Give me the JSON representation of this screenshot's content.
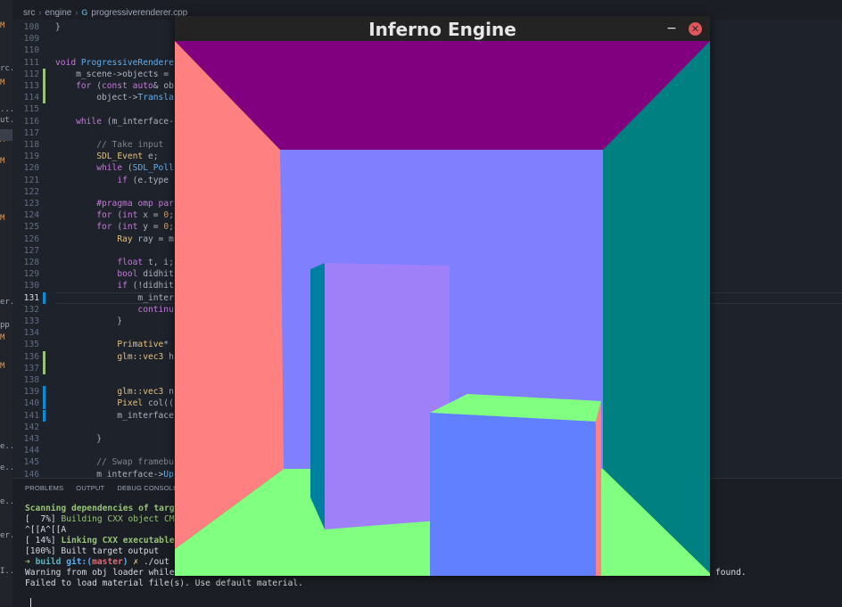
{
  "breadcrumb": [
    "src",
    "engine",
    "progressiverenderer.cpp"
  ],
  "sidebar": [
    {
      "label": "M",
      "modified": true
    },
    {
      "label": "rc..."
    },
    {
      "label": "M",
      "modified": true
    },
    {
      "label": "..."
    },
    {
      "label": "ut..."
    },
    {
      "label": "M",
      "modified": true
    },
    {
      "label": "M",
      "modified": true
    },
    {
      "label": "M",
      "modified": true
    },
    {
      "label": "er..."
    },
    {
      "label": "pp"
    },
    {
      "label": "M",
      "modified": true
    },
    {
      "label": "M",
      "modified": true
    },
    {
      "label": "e..."
    },
    {
      "label": "e..."
    },
    {
      "label": "e..."
    },
    {
      "label": "er..."
    },
    {
      "label": "I..."
    }
  ],
  "editor": {
    "current_line": 131,
    "lines": [
      {
        "n": 108,
        "text": "}"
      },
      {
        "n": 109,
        "text": ""
      },
      {
        "n": 110,
        "text": ""
      },
      {
        "n": 111,
        "text": "void ProgressiveRendere"
      },
      {
        "n": 112,
        "text": "    m_scene->objects = "
      },
      {
        "n": 113,
        "text": "    for (const auto& ob"
      },
      {
        "n": 114,
        "text": "        object->Transla"
      },
      {
        "n": 115,
        "text": ""
      },
      {
        "n": 116,
        "text": "    while (m_interface-"
      },
      {
        "n": 117,
        "text": ""
      },
      {
        "n": 118,
        "text": "        // Take input"
      },
      {
        "n": 119,
        "text": "        SDL_Event e;"
      },
      {
        "n": 120,
        "text": "        while (SDL_Poll"
      },
      {
        "n": 121,
        "text": "            if (e.type "
      },
      {
        "n": 122,
        "text": ""
      },
      {
        "n": 123,
        "text": "        #pragma omp par"
      },
      {
        "n": 124,
        "text": "        for (int x = 0;"
      },
      {
        "n": 125,
        "text": "        for (int y = 0;"
      },
      {
        "n": 126,
        "text": "            Ray ray = m"
      },
      {
        "n": 127,
        "text": ""
      },
      {
        "n": 128,
        "text": "            float t, i;"
      },
      {
        "n": 129,
        "text": "            bool didhit"
      },
      {
        "n": 130,
        "text": "            if (!didhit"
      },
      {
        "n": 131,
        "text": "                m_inter"
      },
      {
        "n": 132,
        "text": "                continu"
      },
      {
        "n": 133,
        "text": "            }"
      },
      {
        "n": 134,
        "text": ""
      },
      {
        "n": 135,
        "text": "            Primative* "
      },
      {
        "n": 136,
        "text": "            glm::vec3 h"
      },
      {
        "n": 137,
        "text": ""
      },
      {
        "n": 138,
        "text": ""
      },
      {
        "n": 139,
        "text": "            glm::vec3 n"
      },
      {
        "n": 140,
        "text": "            Pixel col(("
      },
      {
        "n": 141,
        "text": "            m_interface"
      },
      {
        "n": 142,
        "text": ""
      },
      {
        "n": 143,
        "text": "        }"
      },
      {
        "n": 144,
        "text": ""
      },
      {
        "n": 145,
        "text": "        // Swap framebu"
      },
      {
        "n": 146,
        "text": "        m_interface->Up"
      }
    ]
  },
  "panel": {
    "tabs": [
      "PROBLEMS",
      "OUTPUT",
      "DEBUG CONSOLE"
    ],
    "terminal": [
      {
        "prefix": "",
        "text": "Scanning dependencies of targ"
      },
      {
        "prefix": "[  7%] ",
        "text": "Building CXX object CM"
      },
      {
        "prefix": "",
        "text": "^[[A^[[A"
      },
      {
        "prefix": "[ 14%] ",
        "text": "Linking CXX executable"
      },
      {
        "prefix": "",
        "text": "[100%] Built target output"
      },
      {
        "prompt_arrow": "➜",
        "dir": "build",
        "git_label": "git:(",
        "branch": "master",
        "git_close": ")",
        "dirty": "✗",
        "cmd": "./out"
      },
      {
        "prefix": "",
        "text": "Warning from obj loader while",
        "tail": "found."
      },
      {
        "prefix": "",
        "text": "Failed to load material file(s). Use default material."
      }
    ]
  },
  "window": {
    "title": "Inferno Engine",
    "minimize_icon": "−",
    "close_icon": "✕",
    "colors": {
      "ceiling": "#800080",
      "back_wall": "#8080ff",
      "left_wall": "#ff8080",
      "right_wall": "#008080",
      "floor": "#80ff80",
      "tall_box_front": "#a080f8",
      "tall_box_side": "#0080a0",
      "short_box_front": "#6080ff",
      "short_box_top": "#80ff80",
      "short_box_side": "#ff8080"
    }
  }
}
